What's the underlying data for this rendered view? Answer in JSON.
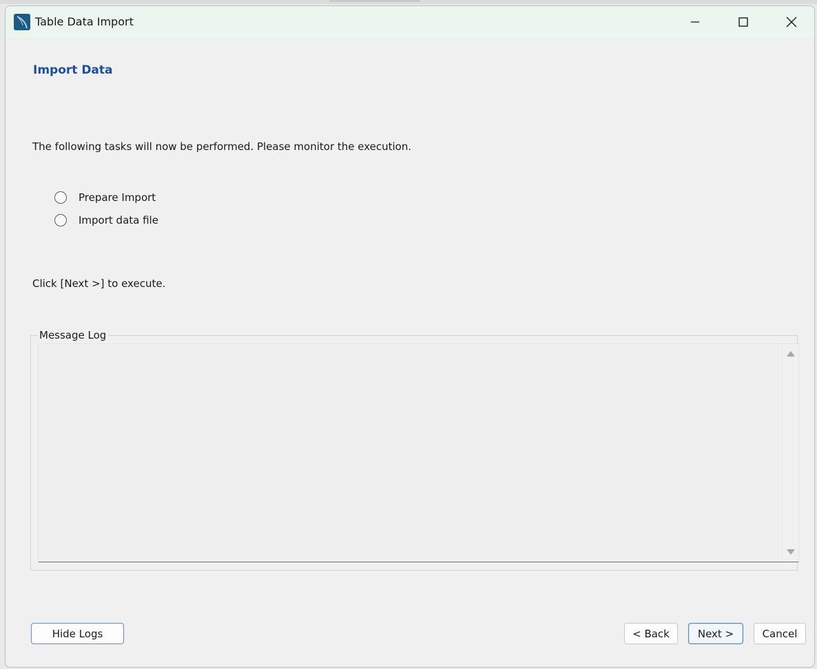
{
  "window": {
    "title": "Table Data Import",
    "icon": "mysql-workbench-dolphin-icon",
    "controls": [
      "minimize-icon",
      "maximize-icon",
      "close-icon"
    ]
  },
  "page": {
    "title": "Import Data",
    "intro": "The following tasks will now be performed. Please monitor the execution.",
    "tasks": [
      {
        "label": "Prepare Import"
      },
      {
        "label": "Import data file"
      }
    ],
    "hint": "Click [Next >] to execute."
  },
  "log": {
    "legend": "Message Log"
  },
  "buttons": {
    "hide_logs": "Hide Logs",
    "back": "< Back",
    "next": "Next >",
    "cancel": "Cancel"
  },
  "colors": {
    "title_accent": "#1c4fa0",
    "titlebar_bg": "#eaf6ee",
    "window_bg": "#f0f0f0",
    "focus_border": "#4f86cf"
  }
}
